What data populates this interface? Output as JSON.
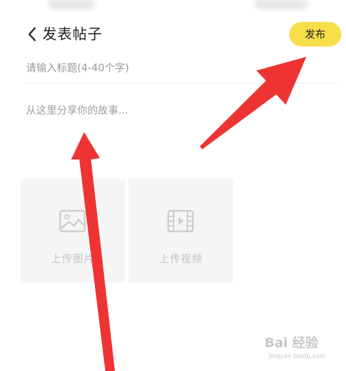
{
  "header": {
    "back_icon": "chevron-left-icon",
    "title": "发表帖子",
    "publish_label": "发布",
    "publish_color": "#f7df4a"
  },
  "form": {
    "title_placeholder": "请输入标题(4-40个字)",
    "content_placeholder": "从这里分享你的故事..."
  },
  "upload": {
    "image_label": "上传图片",
    "image_icon": "image-icon",
    "video_label": "上传视频",
    "video_icon": "film-icon"
  },
  "annotations": {
    "arrow_color": "#ee3333",
    "arrow_icon": "red-arrow-icon"
  },
  "watermark": {
    "logo": "Bai 经验",
    "url": "jingyan.baidu.com"
  }
}
